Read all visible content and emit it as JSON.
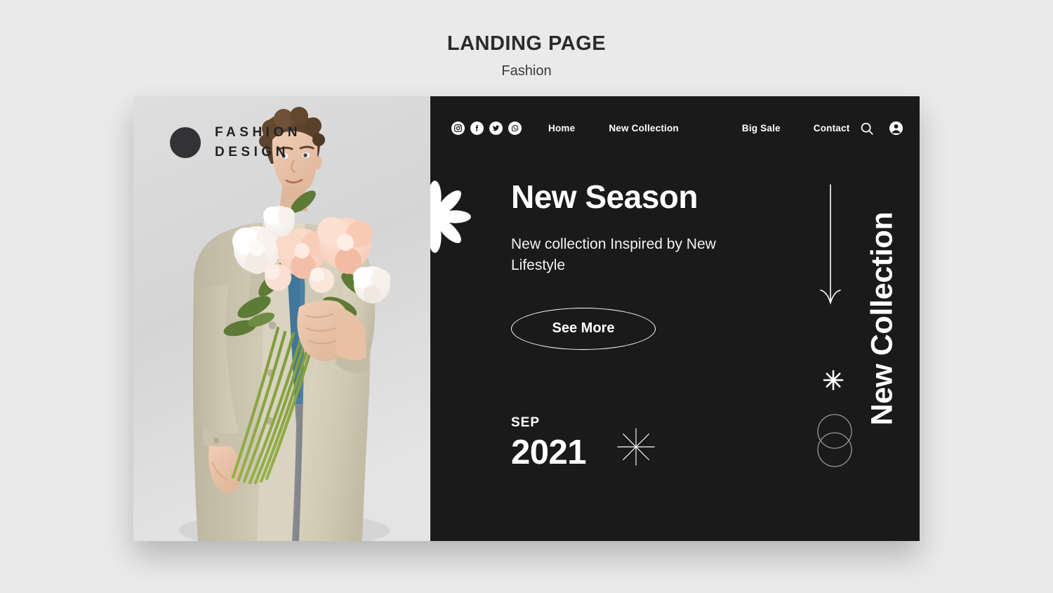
{
  "mockup": {
    "title": "LANDING PAGE",
    "subtitle": "Fashion"
  },
  "colors": {
    "page_background": "#eaeaea",
    "dark_panel": "#1a1a1a",
    "photo_backdrop": "#d8d8d9",
    "accent_text": "#ffffff",
    "logo_text": "#232323"
  },
  "brand": {
    "logo_line1": "FASHION",
    "logo_line2": "DESIGN",
    "logo_mark": "circle-mark"
  },
  "nav": {
    "socials": [
      {
        "name": "instagram-icon",
        "label": "Instagram"
      },
      {
        "name": "facebook-icon",
        "label": "Facebook"
      },
      {
        "name": "twitter-icon",
        "label": "Twitter"
      },
      {
        "name": "whatsapp-icon",
        "label": "WhatsApp"
      }
    ],
    "links": [
      {
        "label": "Home"
      },
      {
        "label": "New Collection"
      },
      {
        "label": "Big Sale"
      },
      {
        "label": "Contact"
      }
    ],
    "icons": [
      {
        "name": "search-icon",
        "label": "Search"
      },
      {
        "name": "account-icon",
        "label": "Account"
      }
    ]
  },
  "hero": {
    "title": "New Season",
    "subtitle": "New collection Inspired by New Lifestyle",
    "cta_label": "See More"
  },
  "date": {
    "month": "SEP",
    "year": "2021",
    "star_icon": "eight-point-star-icon"
  },
  "side": {
    "vertical_title": "New Collection"
  },
  "decorations": {
    "flower": "daisy-flower-icon",
    "arrow": "down-arrow-icon",
    "asterisk": "asterisk-icon",
    "circles": "overlapping-circles-icon"
  },
  "photo": {
    "alt": "Man in beige trench coat holding a bouquet of peonies"
  }
}
